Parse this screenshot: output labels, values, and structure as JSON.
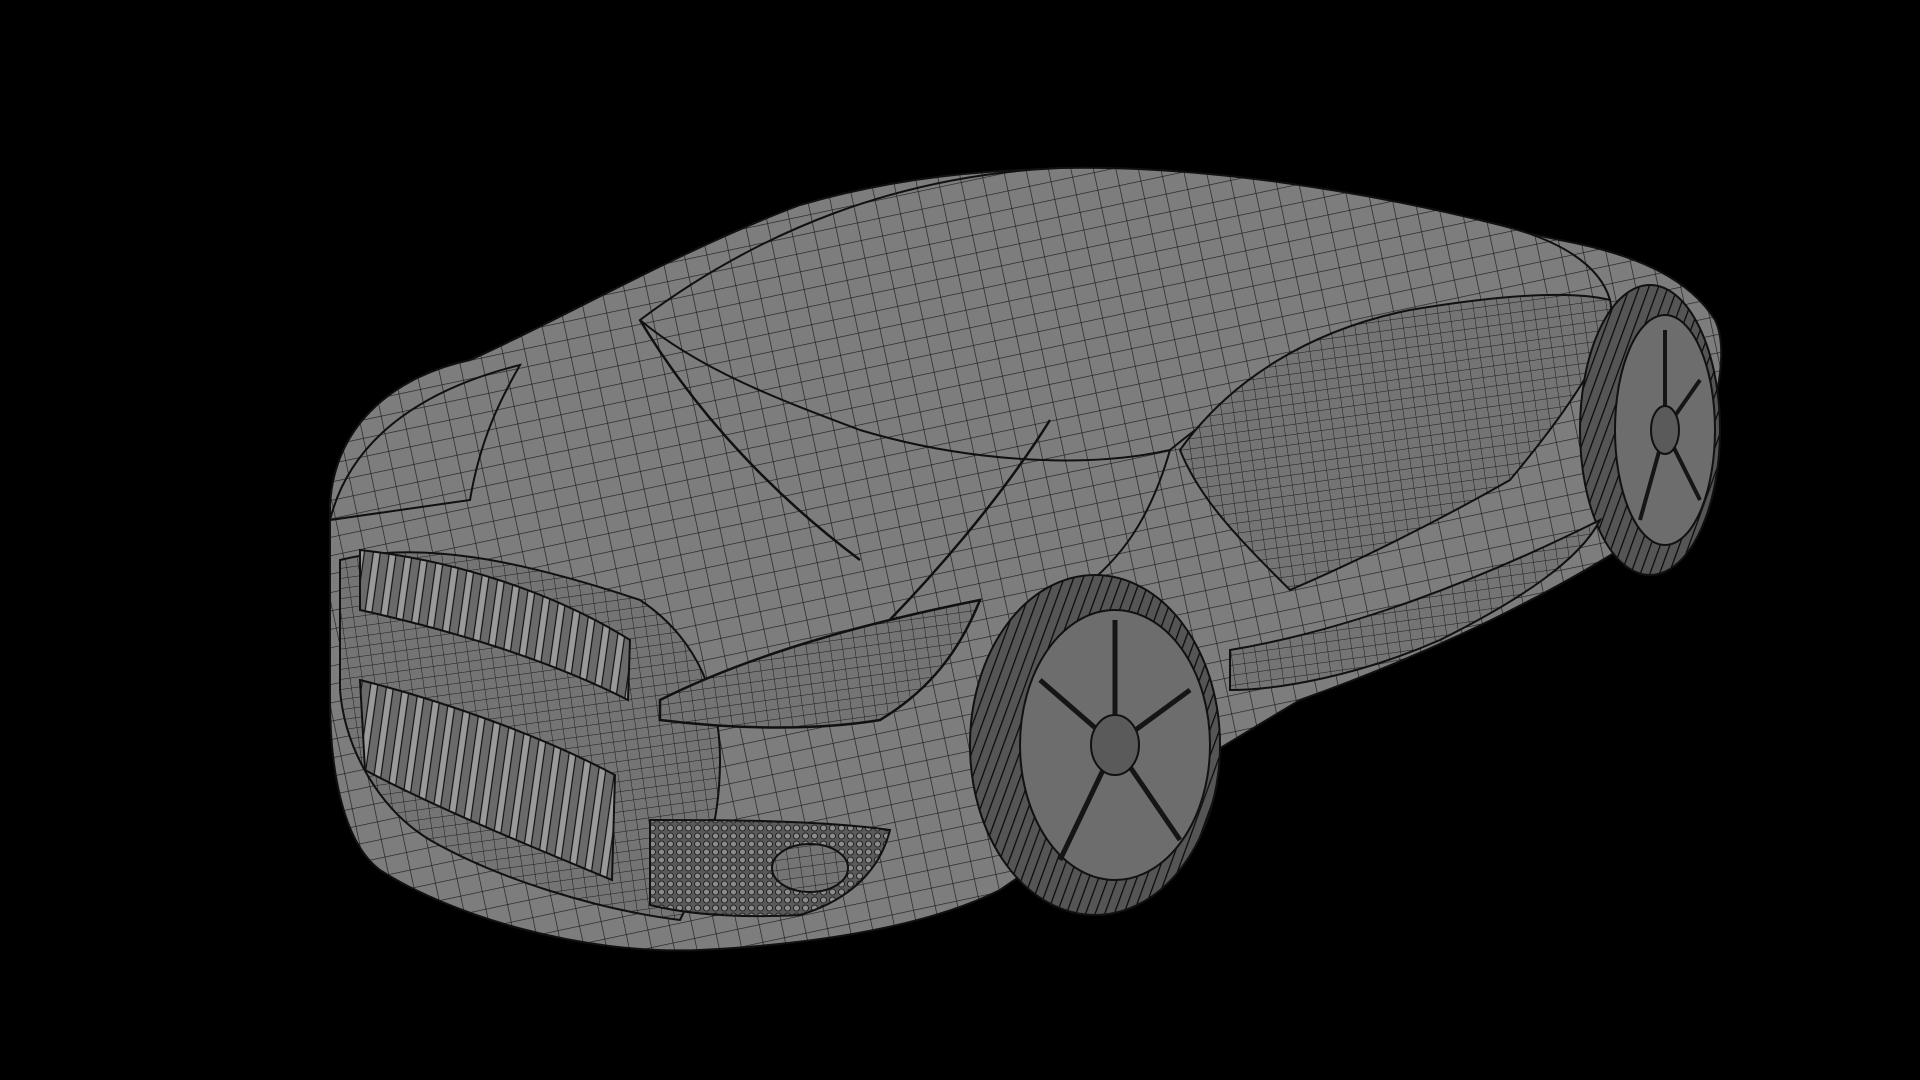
{
  "viewport": {
    "background": "#000000",
    "subject": "car-wireframe-model",
    "shading": "flat-grey-with-black-wire",
    "body_color": "#7d7d7d",
    "wire_color": "#1a1a1a"
  }
}
